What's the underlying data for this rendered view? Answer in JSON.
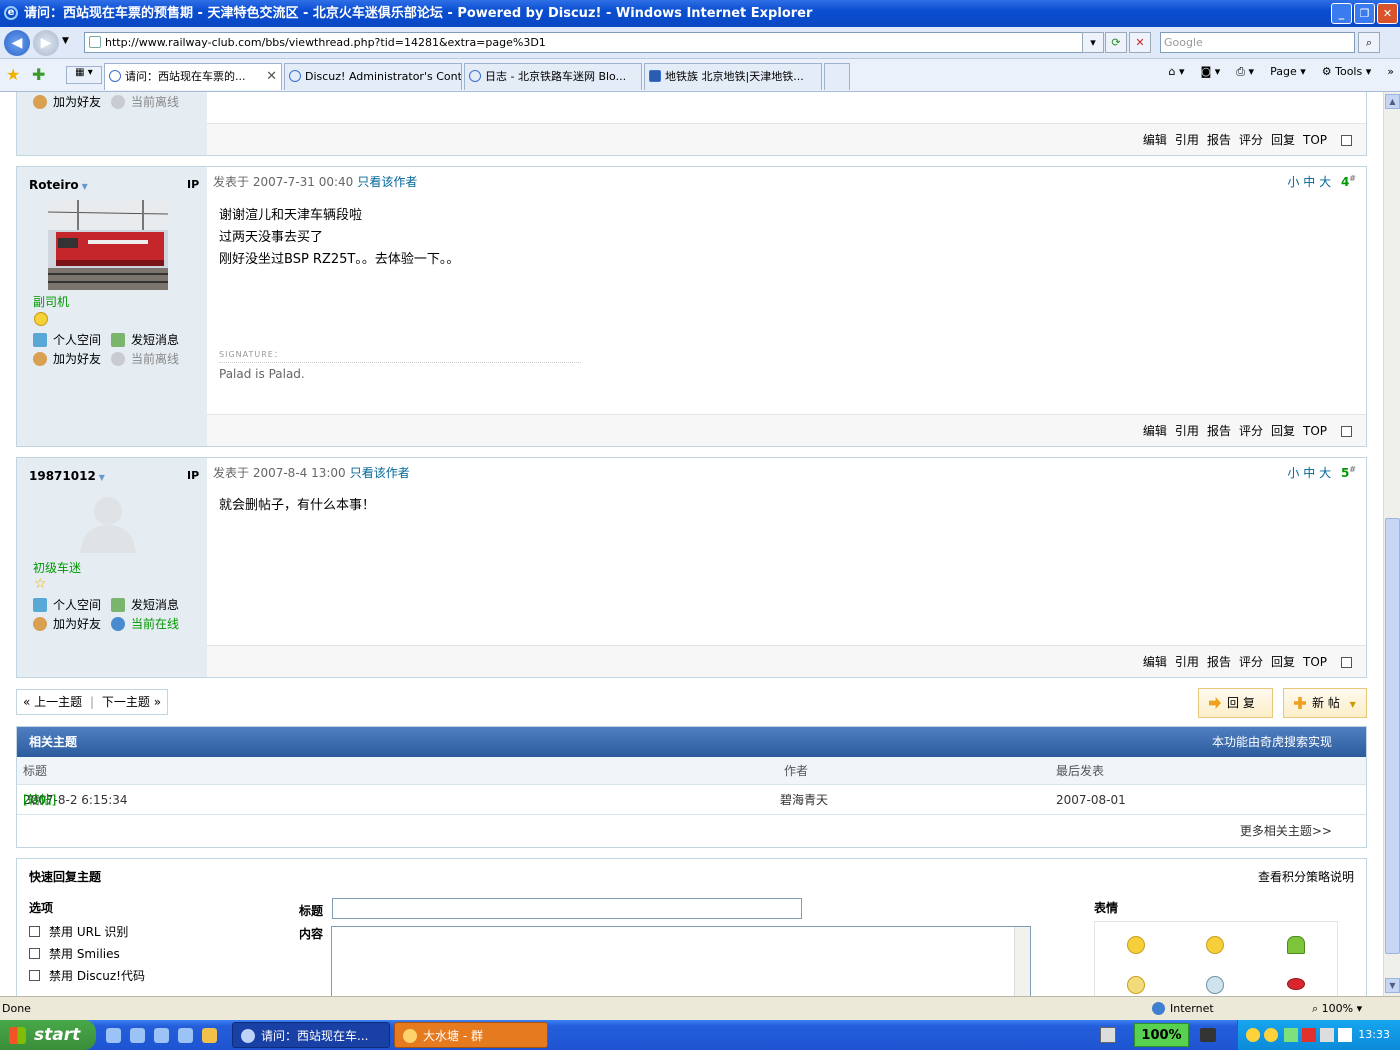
{
  "window": {
    "title": "请问：西站现在车票的预售期 - 天津特色交流区 - 北京火车迷俱乐部论坛 - Powered by Discuz! - Windows Internet Explorer"
  },
  "address": {
    "url": "http://www.railway-club.com/bbs/viewthread.php?tid=14281&extra=page%3D1",
    "search_placeholder": "Google"
  },
  "tabs": [
    {
      "label": "请问：西站现在车票的..."
    },
    {
      "label": "Discuz! Administrator's Contr..."
    },
    {
      "label": "日志 - 北京铁路车迷网 Blo..."
    },
    {
      "label": "地铁族 北京地铁|天津地铁..."
    }
  ],
  "toolbar": {
    "page": "Page",
    "tools": "Tools"
  },
  "prev_post": {
    "links": [
      "加为好友",
      "当前离线"
    ],
    "actions": [
      "编辑",
      "引用",
      "报告",
      "评分",
      "回复",
      "TOP"
    ]
  },
  "posts": [
    {
      "author": "Roteiro",
      "ip": "IP",
      "rank": "副司机",
      "links": [
        "个人空间",
        "发短消息",
        "加为好友",
        "当前离线"
      ],
      "date": "发表于  2007-7-31 00:40",
      "only_author": "只看该作者",
      "sizes": [
        "小",
        "中",
        "大"
      ],
      "floor": "4",
      "floor_mark": "#",
      "lines": [
        "谢谢渲儿和天津车辆段啦",
        "过两天没事去买了",
        "刚好没坐过BSP RZ25T。。去体验一下。。"
      ],
      "signature_label": "SIGNATURE：",
      "signature": "Palad is Palad.",
      "actions": [
        "编辑",
        "引用",
        "报告",
        "评分",
        "回复",
        "TOP"
      ]
    },
    {
      "author": "19871012",
      "ip": "IP",
      "rank": "初级车迷",
      "links": [
        "个人空间",
        "发短消息",
        "加为好友",
        "当前在线"
      ],
      "date": "发表于  2007-8-4 13:00",
      "only_author": "只看该作者",
      "sizes": [
        "小",
        "中",
        "大"
      ],
      "floor": "5",
      "floor_mark": "#",
      "lines": [
        "就会删帖子，有什么本事！"
      ],
      "actions": [
        "编辑",
        "引用",
        "报告",
        "评分",
        "回复",
        "TOP"
      ]
    }
  ],
  "pager": {
    "prev": "上一主题",
    "next": "下一主题"
  },
  "buttons": {
    "reply": "回 复",
    "new": "新 帖"
  },
  "related": {
    "title": "相关主题",
    "provider": "本功能由奇虎搜索实现",
    "cols": [
      "标题",
      "作者",
      "最后发表"
    ],
    "row": {
      "prefix": "[站外]",
      "title": "2007-8-2 6:15:34",
      "tag": "[转帖]",
      "author": "碧海青天",
      "last": "2007-08-01"
    },
    "more": "更多相关主题>>"
  },
  "quick_reply": {
    "title": "快速回复主题",
    "policy": "查看积分策略说明",
    "options_title": "选项",
    "options": [
      "禁用 URL 识别",
      "禁用 Smilies",
      "禁用 Discuz!代码"
    ],
    "subject_label": "标题",
    "content_label": "内容",
    "emoticons_label": "表情"
  },
  "status": {
    "text": "Done",
    "zone": "Internet",
    "zoom": "100%"
  },
  "taskbar": {
    "start": "start",
    "tasks": [
      "请问：西站现在车...",
      "大水塘 - 群"
    ],
    "battery": "100%",
    "clock": "13:33"
  }
}
